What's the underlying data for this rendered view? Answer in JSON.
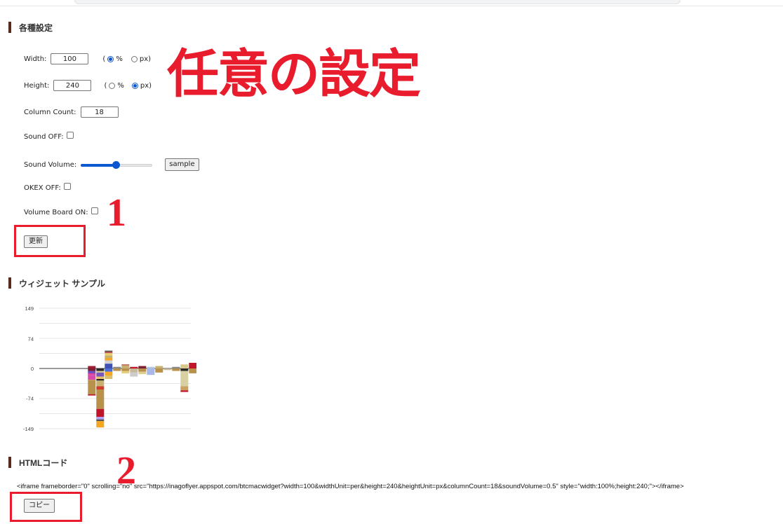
{
  "sections": {
    "settings": "各種設定",
    "widget_sample": "ウィジェット サンプル",
    "html_code": "HTMLコード"
  },
  "form": {
    "width_label": "Width:",
    "width_value": "100",
    "width_unit_open": "(",
    "width_unit_percent": "%",
    "width_unit_px": "px)",
    "width_unit_selected": "%",
    "height_label": "Height:",
    "height_value": "240",
    "height_unit_open": "(",
    "height_unit_percent": "%",
    "height_unit_px": "px)",
    "height_unit_selected": "px",
    "column_count_label": "Column Count:",
    "column_count_value": "18",
    "sound_off_label": "Sound OFF:",
    "sound_off_checked": false,
    "sound_volume_label": "Sound Volume:",
    "sound_volume_value": 0.5,
    "sample_button": "sample",
    "okex_off_label": "OKEX OFF:",
    "okex_off_checked": false,
    "volume_board_label": "Volume Board ON:",
    "volume_board_checked": false,
    "update_button": "更新"
  },
  "annotations": {
    "title": "任意の設定",
    "step1": "1",
    "step2": "2",
    "color": "#e81c2c"
  },
  "chart_data": {
    "type": "bar",
    "stacked": true,
    "ylim": [
      -149,
      149
    ],
    "yticks": [
      "149",
      "74",
      "0",
      "-74",
      "-149"
    ],
    "grid": true,
    "columns": 18,
    "bars": [
      {
        "col": 3,
        "segments": [
          {
            "from": 0,
            "to": 6,
            "color": "#9b1b30"
          },
          {
            "from": 0,
            "to": -6,
            "color": "#7a2030"
          },
          {
            "from": -6,
            "to": -12,
            "color": "#6a4fc4"
          },
          {
            "from": -12,
            "to": -16,
            "color": "#e040a0"
          },
          {
            "from": -16,
            "to": -28,
            "color": "#d84aa8"
          },
          {
            "from": -28,
            "to": -64,
            "color": "#b8914a"
          },
          {
            "from": -64,
            "to": -67,
            "color": "#c0142a"
          }
        ]
      },
      {
        "col": 4,
        "segments": [
          {
            "from": 0,
            "to": -6,
            "color": "#2a2a2a"
          },
          {
            "from": -6,
            "to": -10,
            "color": "#d8c88a"
          },
          {
            "from": -10,
            "to": -20,
            "color": "#7755bb"
          },
          {
            "from": -20,
            "to": -26,
            "color": "#e6c36a"
          },
          {
            "from": -26,
            "to": -30,
            "color": "#222"
          },
          {
            "from": -30,
            "to": -44,
            "color": "#c8b070"
          },
          {
            "from": -44,
            "to": -52,
            "color": "#cf3b2c"
          },
          {
            "from": -52,
            "to": -100,
            "color": "#b8914a"
          },
          {
            "from": -100,
            "to": -120,
            "color": "#c0142a"
          },
          {
            "from": -120,
            "to": -126,
            "color": "#b0a0ff"
          },
          {
            "from": -126,
            "to": -130,
            "color": "#555"
          },
          {
            "from": -130,
            "to": -146,
            "color": "#f5a623"
          }
        ]
      },
      {
        "col": 5,
        "segments": [
          {
            "from": 0,
            "to": 12,
            "color": "#3f51b5"
          },
          {
            "from": 12,
            "to": 20,
            "color": "#d0d0d0"
          },
          {
            "from": 20,
            "to": 26,
            "color": "#f5a623"
          },
          {
            "from": 26,
            "to": 32,
            "color": "#c8b070"
          },
          {
            "from": 32,
            "to": 38,
            "color": "#e8d070"
          },
          {
            "from": 38,
            "to": 42,
            "color": "#b55"
          },
          {
            "from": 42,
            "to": 44,
            "color": "#333"
          },
          {
            "from": 0,
            "to": -8,
            "color": "#4a6fd8"
          },
          {
            "from": -8,
            "to": -18,
            "color": "#f5a623"
          },
          {
            "from": -18,
            "to": -26,
            "color": "#d8c070"
          }
        ]
      },
      {
        "col": 6,
        "segments": [
          {
            "from": 0,
            "to": 4,
            "color": "#888"
          },
          {
            "from": 0,
            "to": -6,
            "color": "#b8914a"
          }
        ]
      },
      {
        "col": 7,
        "segments": [
          {
            "from": 0,
            "to": 8,
            "color": "#c8b070"
          },
          {
            "from": 8,
            "to": 10,
            "color": "#b0453a"
          },
          {
            "from": 0,
            "to": -6,
            "color": "#b8914a"
          },
          {
            "from": -6,
            "to": -12,
            "color": "#e6d080"
          }
        ]
      },
      {
        "col": 8,
        "segments": [
          {
            "from": 0,
            "to": 4,
            "color": "#c0142a"
          },
          {
            "from": 0,
            "to": -10,
            "color": "#c8b89a"
          },
          {
            "from": -10,
            "to": -20,
            "color": "#cccccc"
          }
        ]
      },
      {
        "col": 9,
        "segments": [
          {
            "from": 0,
            "to": 6,
            "color": "#7a2030"
          },
          {
            "from": 0,
            "to": -8,
            "color": "#b8914a"
          },
          {
            "from": -8,
            "to": -14,
            "color": "#e0d090"
          }
        ]
      },
      {
        "col": 10,
        "segments": [
          {
            "from": 0,
            "to": 4,
            "color": "#b0c4de"
          },
          {
            "from": 0,
            "to": -16,
            "color": "#a8b8e8"
          }
        ]
      },
      {
        "col": 11,
        "segments": [
          {
            "from": 0,
            "to": 6,
            "color": "#c8b070"
          },
          {
            "from": 0,
            "to": -10,
            "color": "#b8914a"
          }
        ]
      },
      {
        "col": 12,
        "segments": [
          {
            "from": 0,
            "to": -4,
            "color": "#c8b89a"
          }
        ]
      },
      {
        "col": 13,
        "segments": [
          {
            "from": 0,
            "to": 4,
            "color": "#888"
          },
          {
            "from": 0,
            "to": -6,
            "color": "#b8914a"
          }
        ]
      },
      {
        "col": 14,
        "segments": [
          {
            "from": 0,
            "to": 10,
            "color": "#d8c88a"
          },
          {
            "from": 0,
            "to": -6,
            "color": "#2a2a2a"
          },
          {
            "from": -6,
            "to": -44,
            "color": "#d8d0a0"
          },
          {
            "from": -44,
            "to": -54,
            "color": "#c8a060"
          },
          {
            "from": -54,
            "to": -58,
            "color": "#c0142a"
          }
        ]
      },
      {
        "col": 15,
        "segments": [
          {
            "from": 0,
            "to": 14,
            "color": "#c0142a"
          },
          {
            "from": 0,
            "to": -12,
            "color": "#b8914a"
          }
        ]
      }
    ]
  },
  "html_code": {
    "snippet": "<iframe frameborder=\"0\" scrolling=\"no\" src=\"https://inagoflyer.appspot.com/btcmacwidget?width=100&widthUnit=per&height=240&heightUnit=px&columnCount=18&soundVolume=0.5\" style=\"width:100%;height:240;\"></iframe>",
    "copy_button": "コピー"
  }
}
